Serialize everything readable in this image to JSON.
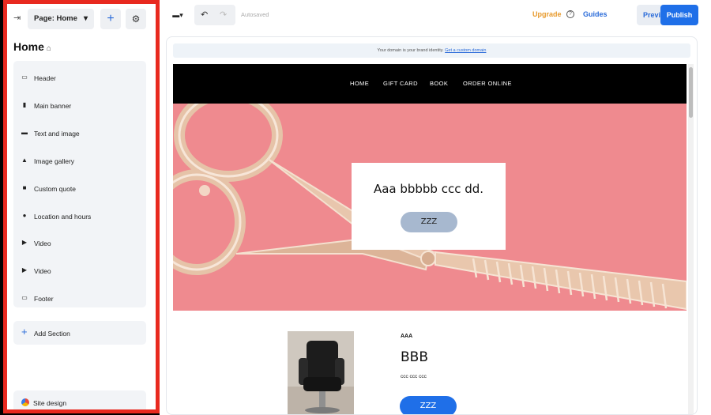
{
  "left_panel": {
    "page_select_label": "Page: Home",
    "page_title": "Home",
    "sections": [
      {
        "label": "Header",
        "icon": "header-icon"
      },
      {
        "label": "Main banner",
        "icon": "bookmark-icon"
      },
      {
        "label": "Text and image",
        "icon": "text-image-icon"
      },
      {
        "label": "Image gallery",
        "icon": "image-icon"
      },
      {
        "label": "Custom quote",
        "icon": "quote-icon"
      },
      {
        "label": "Location and hours",
        "icon": "location-pin-icon"
      },
      {
        "label": "Video",
        "icon": "play-icon"
      },
      {
        "label": "Video",
        "icon": "play-icon"
      },
      {
        "label": "Footer",
        "icon": "footer-icon"
      }
    ],
    "add_section_label": "Add Section",
    "site_design_label": "Site design"
  },
  "toolbar": {
    "autosaved_label": "Autosaved",
    "upgrade_label": "Upgrade",
    "guides_label": "Guides",
    "preview_label": "Preview",
    "publish_label": "Publish"
  },
  "site": {
    "domain_text": "Your domain is your brand identity.",
    "domain_link": "Get a custom domain",
    "nav": [
      "HOME",
      "GIFT CARD",
      "BOOK",
      "ORDER ONLINE"
    ],
    "hero_headline": "Aaa bbbbb ccc dd.",
    "hero_button": "ZZZ",
    "content_eyebrow": "AAA",
    "content_heading": "BBB",
    "content_body": "ccc ccc ccc",
    "content_button": "ZZZ"
  },
  "colors": {
    "highlight_border": "#e8291f",
    "accent_blue": "#1f6fe8",
    "upgrade_orange": "#e89a2c",
    "hero_pink": "#ef8a8f"
  }
}
